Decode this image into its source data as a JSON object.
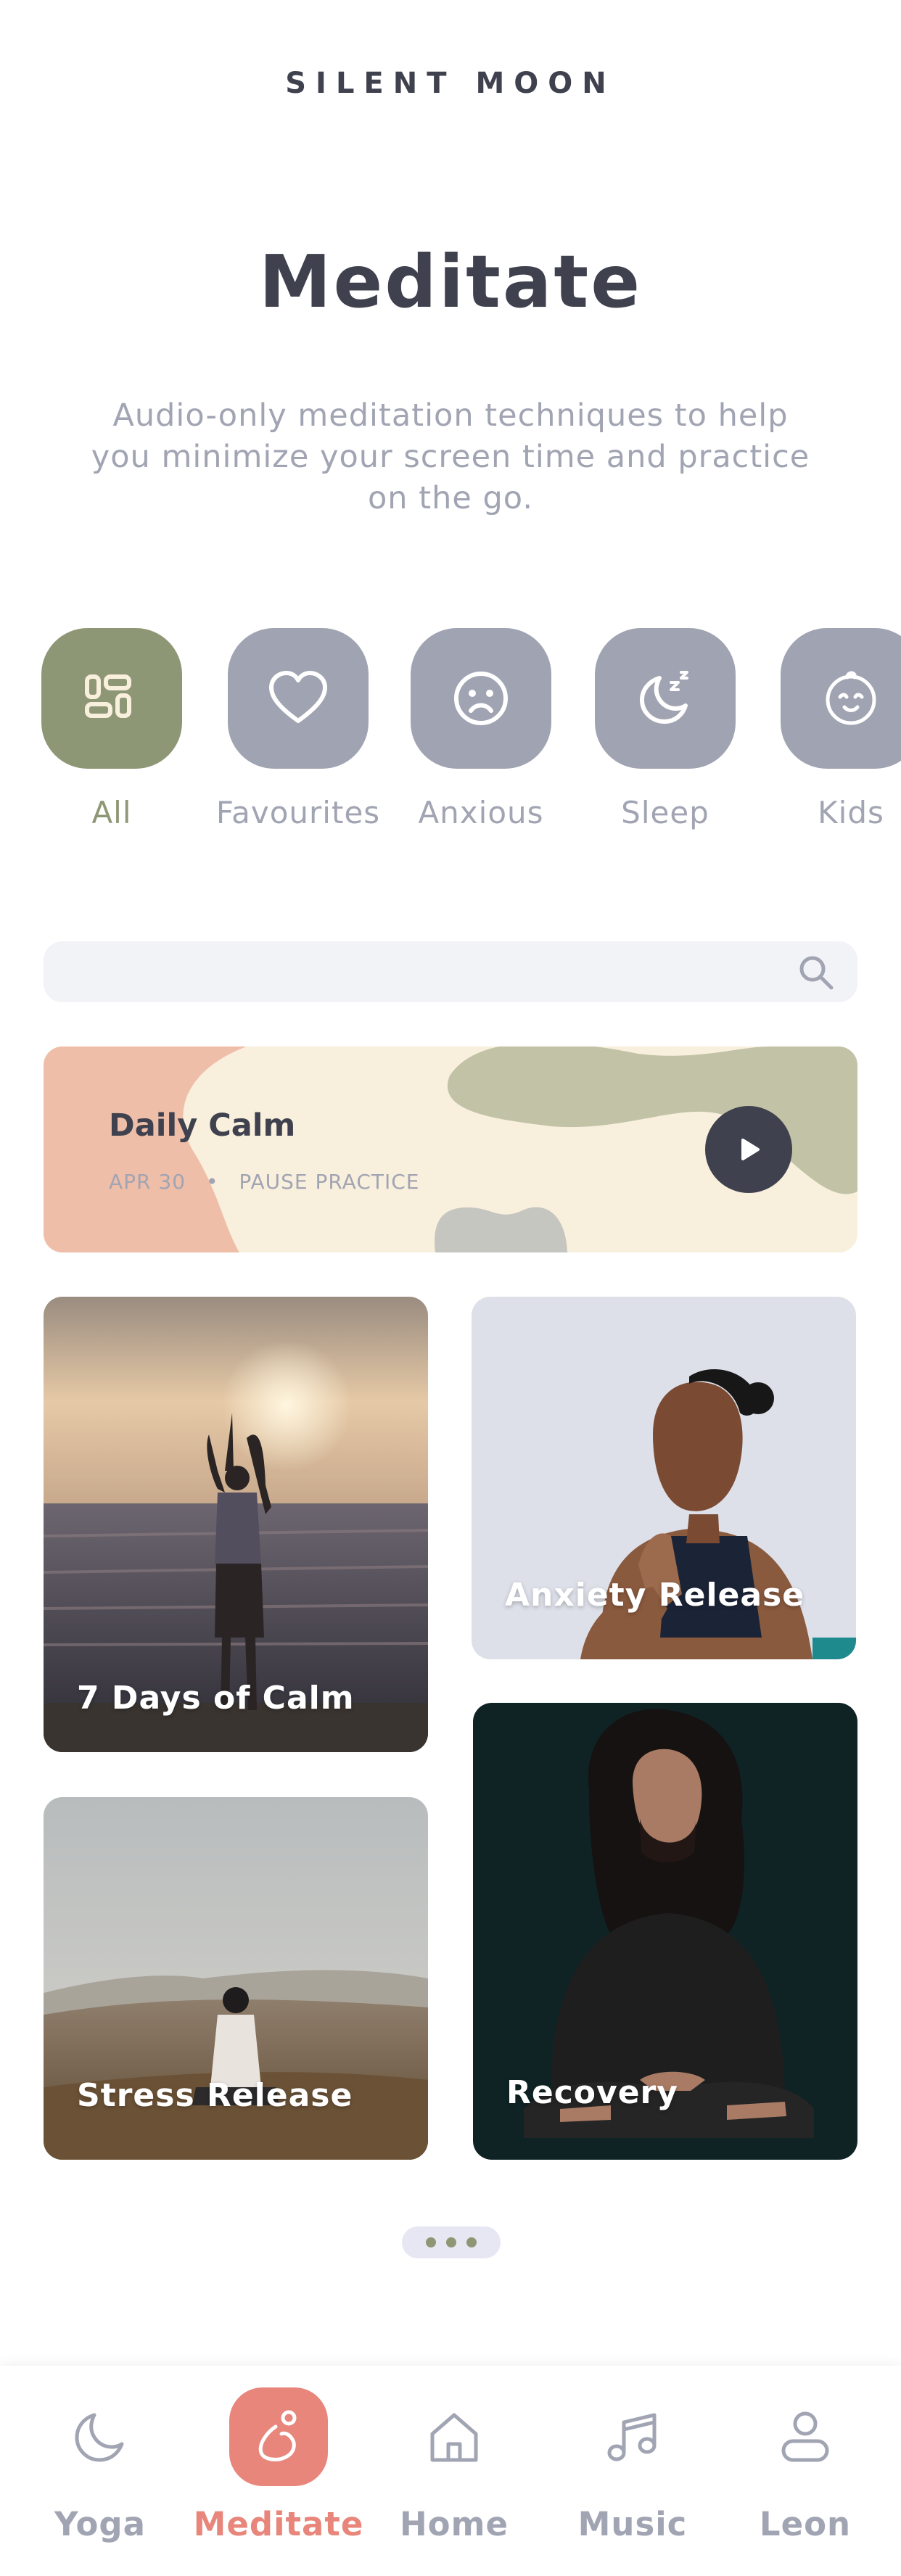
{
  "brand": "SILENT  MOON",
  "page_title": "Meditate",
  "subtitle": "Audio-only meditation techniques to help you minimize your screen time and practice on the go.",
  "categories": [
    {
      "label": "All",
      "icon": "grid-icon",
      "active": true
    },
    {
      "label": "Favourites",
      "icon": "heart-icon",
      "active": false
    },
    {
      "label": "Anxious",
      "icon": "sad-face-icon",
      "active": false
    },
    {
      "label": "Sleep",
      "icon": "moon-zz-icon",
      "active": false
    },
    {
      "label": "Kids",
      "icon": "baby-face-icon",
      "active": false
    }
  ],
  "search": {
    "placeholder": "",
    "icon": "search-icon"
  },
  "daily": {
    "title": "Daily Calm",
    "date": "APR 30",
    "separator": "•",
    "subtitle": "PAUSE PRACTICE",
    "icon": "play-icon"
  },
  "cards": [
    {
      "label": "7 Days of Calm"
    },
    {
      "label": "Anxiety Release"
    },
    {
      "label": "Stress Release"
    },
    {
      "label": "Recovery"
    }
  ],
  "tabs": [
    {
      "label": "Yoga",
      "icon": "moon-icon",
      "active": false
    },
    {
      "label": "Meditate",
      "icon": "meditate-icon",
      "active": true
    },
    {
      "label": "Home",
      "icon": "home-icon",
      "active": false
    },
    {
      "label": "Music",
      "icon": "music-icon",
      "active": false
    },
    {
      "label": "Leon",
      "icon": "user-icon",
      "active": false
    }
  ],
  "colors": {
    "accent_green": "#8e9775",
    "accent_coral": "#e8867c",
    "inactive_gray": "#a0a3b1",
    "text_dark": "#3f414e",
    "daily_bg": "#f9efdd"
  }
}
